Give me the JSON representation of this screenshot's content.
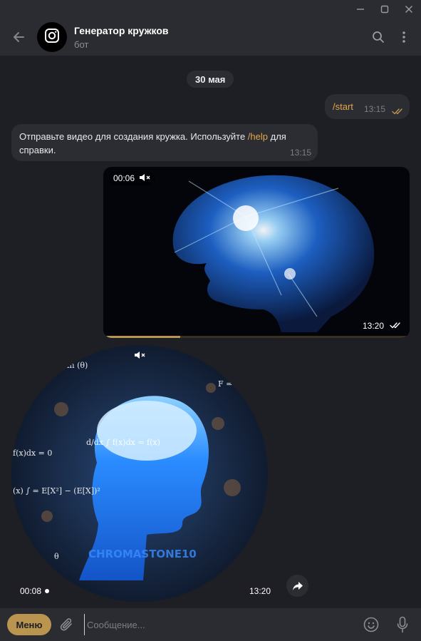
{
  "window": {
    "minimize_icon": "minimize-icon",
    "maximize_icon": "maximize-icon",
    "close_icon": "close-icon"
  },
  "header": {
    "title": "Генератор кружков",
    "subtitle": "бот",
    "avatar_icon": "instagram-camera-icon"
  },
  "chat": {
    "date_separator": "30 мая",
    "messages": [
      {
        "direction": "out",
        "type": "text",
        "text": "/start",
        "time": "13:15",
        "status": "read"
      },
      {
        "direction": "in",
        "type": "text",
        "text_before": "Отправьте видео для создания кружка. Используйте ",
        "command": "/help",
        "text_after": " для справки.",
        "time": "13:15"
      },
      {
        "direction": "out",
        "type": "video",
        "duration": "00:06",
        "time": "13:20",
        "status": "read",
        "muted": true,
        "progress": 0.25
      },
      {
        "direction": "out",
        "type": "round-video",
        "duration": "00:08",
        "time": "13:20",
        "muted": true
      }
    ]
  },
  "composer": {
    "menu_label": "Меню",
    "placeholder": "Сообщение..."
  },
  "colors": {
    "accent": "#b9954f",
    "command": "#e5a64a",
    "bubble": "#2c2d33",
    "background": "#1e1f24"
  }
}
